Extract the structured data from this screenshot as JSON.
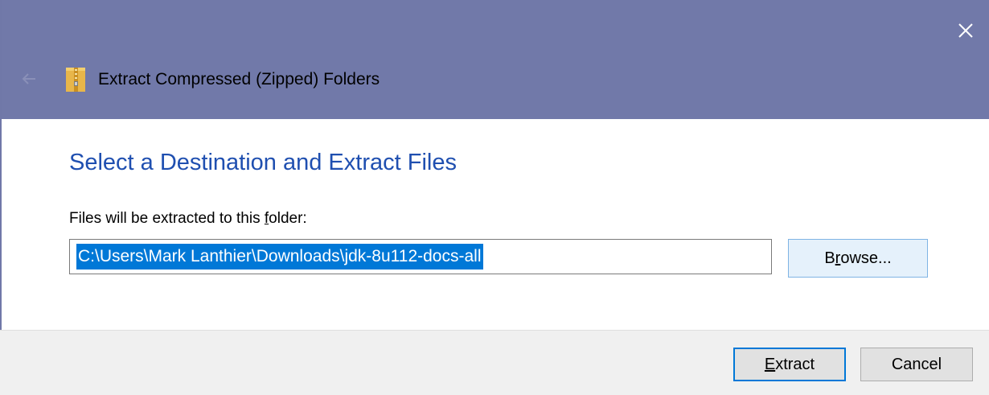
{
  "window": {
    "title": "Extract Compressed (Zipped) Folders",
    "close_glyph": "✕",
    "back_icon": "back-arrow-icon",
    "app_icon": "zip-folder-icon"
  },
  "content": {
    "heading": "Select a Destination and Extract Files",
    "label_before": "Files will be extracted to this ",
    "label_hotkey": "f",
    "label_after": "older:",
    "path_value": "C:\\Users\\Mark Lanthier\\Downloads\\jdk-8u112-docs-all",
    "browse_hotkey": "r",
    "browse_before": "B",
    "browse_after": "owse..."
  },
  "footer": {
    "extract_hotkey": "E",
    "extract_after": "xtract",
    "cancel_label": "Cancel"
  },
  "colors": {
    "titlebar": "#7179a9",
    "heading": "#1f4fb0",
    "selection": "#0078d7",
    "footer": "#f0f0f0"
  }
}
